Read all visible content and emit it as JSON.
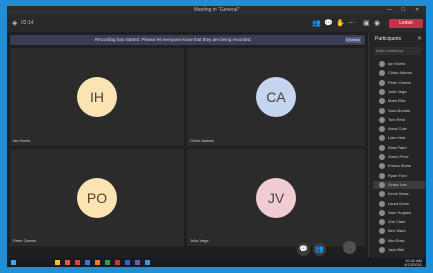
{
  "window": {
    "title": "Meeting in \"General\"",
    "minimize": "—",
    "maximize": "☐",
    "close": "✕"
  },
  "toolbar": {
    "timer": "02:14",
    "leave_label": "Leave"
  },
  "banner": {
    "message": "Recording has started. Please let everyone know that they are being recorded.",
    "dismiss_label": "Dismiss"
  },
  "tiles": [
    {
      "initials": "IH",
      "name": "Ian Harris",
      "color": "#fbe4b1"
    },
    {
      "initials": "CA",
      "name": "Chloe Adams",
      "color": "#c5d4ef"
    },
    {
      "initials": "PO",
      "name": "Peter Owens",
      "color": "#fbe4b1"
    },
    {
      "initials": "JV",
      "name": "Julia Vega",
      "color": "#f1ccd3"
    }
  ],
  "controls": {
    "chat": "💬",
    "participants": "👥",
    "hangup": "📞"
  },
  "panel": {
    "title": "Participants",
    "search_placeholder": "Invite someone",
    "people": [
      "Ian Harris",
      "Chloe Adams",
      "Peter Owens",
      "Julia Vega",
      "Mark Ellis",
      "Sara Brooks",
      "Tom Reid",
      "Anna Cole",
      "Liam Hart",
      "Nina Patel",
      "Owen Price",
      "Emma Stone",
      "Ryan Ford",
      "Grace Lee",
      "Kevin Moss",
      "Laura Dean",
      "Sam Hughes",
      "Zoe Clark",
      "Ben Ward",
      "Mia Ross",
      "Jack Bell"
    ]
  },
  "taskbar": {
    "time": "10:42 AM",
    "date": "4/12/2021"
  },
  "colors": {
    "accent": "#c4314b",
    "frame": "#1e8ed6"
  }
}
